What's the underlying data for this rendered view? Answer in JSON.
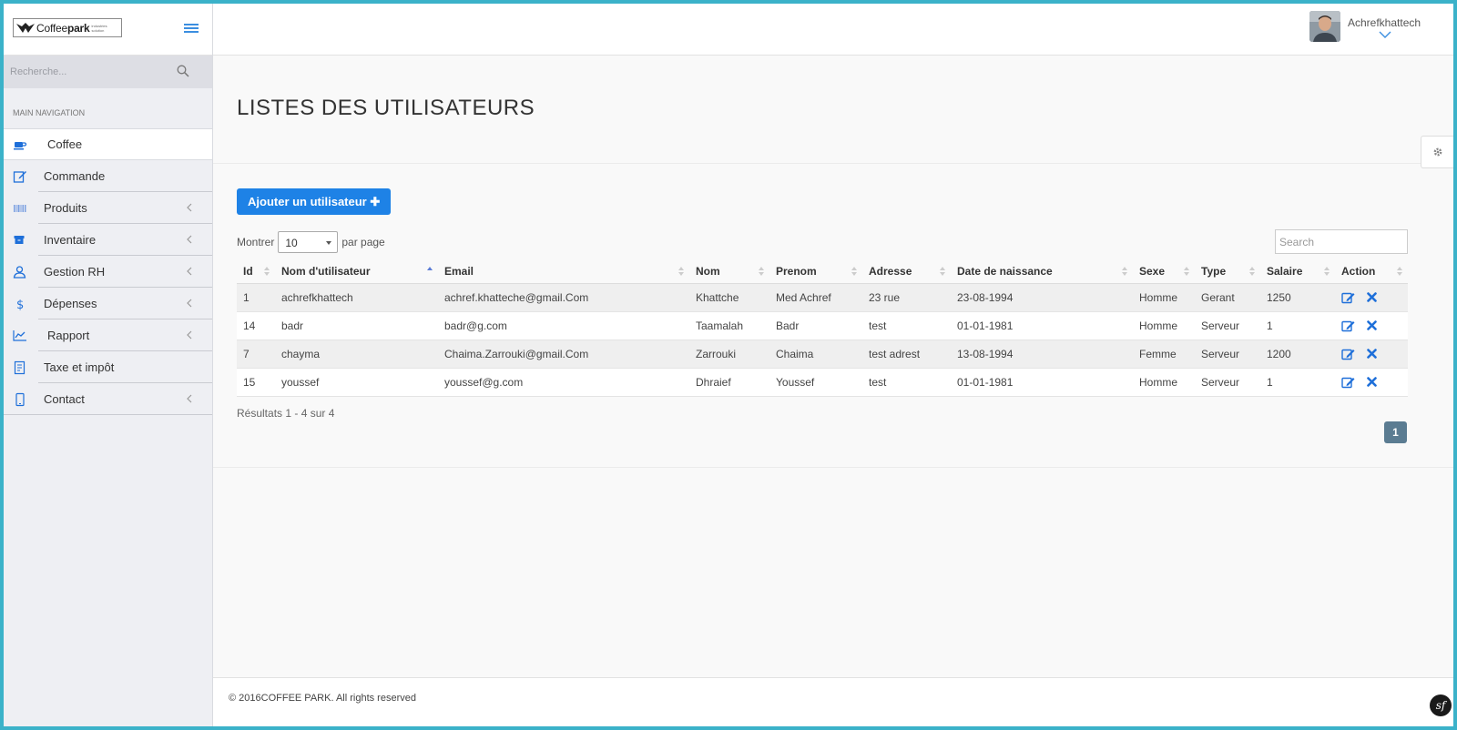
{
  "brand": {
    "logo_prefix": "Coffee",
    "logo_bold": "park",
    "logo_tagline": "industries solution"
  },
  "sidebar": {
    "search_placeholder": "Recherche...",
    "nav_header": "MAIN NAVIGATION",
    "items": [
      {
        "label": "Coffee",
        "icon": "coffee-icon",
        "chevron": false
      },
      {
        "label": "Commande",
        "icon": "edit-icon",
        "chevron": false
      },
      {
        "label": "Produits",
        "icon": "barcode-icon",
        "chevron": true
      },
      {
        "label": "Inventaire",
        "icon": "archive-icon",
        "chevron": true
      },
      {
        "label": "Gestion RH",
        "icon": "user-icon",
        "chevron": true
      },
      {
        "label": "Dépenses",
        "icon": "dollar-icon",
        "chevron": true
      },
      {
        "label": "Rapport",
        "icon": "line-chart-icon",
        "chevron": true
      },
      {
        "label": "Taxe et impôt",
        "icon": "receipt-icon",
        "chevron": false
      },
      {
        "label": "Contact",
        "icon": "mobile-icon",
        "chevron": true
      }
    ]
  },
  "header": {
    "username": "Achrefkhattech"
  },
  "main": {
    "title": "LISTES DES UTILISATEURS",
    "add_button": "Ajouter un utilisateur ✚",
    "show_label": "Montrer",
    "page_size": "10",
    "per_page_label": "par page",
    "search_placeholder": "Search",
    "results_text": "Résultats 1 - 4 sur 4",
    "current_page": "1"
  },
  "table": {
    "columns": [
      "Id",
      "Nom d'utilisateur",
      "Email",
      "Nom",
      "Prenom",
      "Adresse",
      "Date de naissance",
      "Sexe",
      "Type",
      "Salaire",
      "Action"
    ],
    "sorted_column": "Nom d'utilisateur",
    "rows": [
      {
        "id": "1",
        "username": "achrefkhattech",
        "email": "achref.khatteche@gmail.Com",
        "nom": "Khattche",
        "prenom": "Med Achref",
        "adresse": "23 rue",
        "date": "23-08-1994",
        "sexe": "Homme",
        "type": "Gerant",
        "salaire": "1250"
      },
      {
        "id": "14",
        "username": "badr",
        "email": "badr@g.com",
        "nom": "Taamalah",
        "prenom": "Badr",
        "adresse": "test",
        "date": "01-01-1981",
        "sexe": "Homme",
        "type": "Serveur",
        "salaire": "1"
      },
      {
        "id": "7",
        "username": "chayma",
        "email": "Chaima.Zarrouki@gmail.Com",
        "nom": "Zarrouki",
        "prenom": "Chaima",
        "adresse": "test adrest",
        "date": "13-08-1994",
        "sexe": "Femme",
        "type": "Serveur",
        "salaire": "1200"
      },
      {
        "id": "15",
        "username": "youssef",
        "email": "youssef@g.com",
        "nom": "Dhraief",
        "prenom": "Youssef",
        "adresse": "test",
        "date": "01-01-1981",
        "sexe": "Homme",
        "type": "Serveur",
        "salaire": "1"
      }
    ]
  },
  "footer": {
    "text": "© 2016COFFEE PARK. All rights reserved",
    "badge": "sf"
  },
  "colors": {
    "frame": "#3bb2c9",
    "accent": "#1e82e6",
    "pagination": "#5b7c92"
  }
}
